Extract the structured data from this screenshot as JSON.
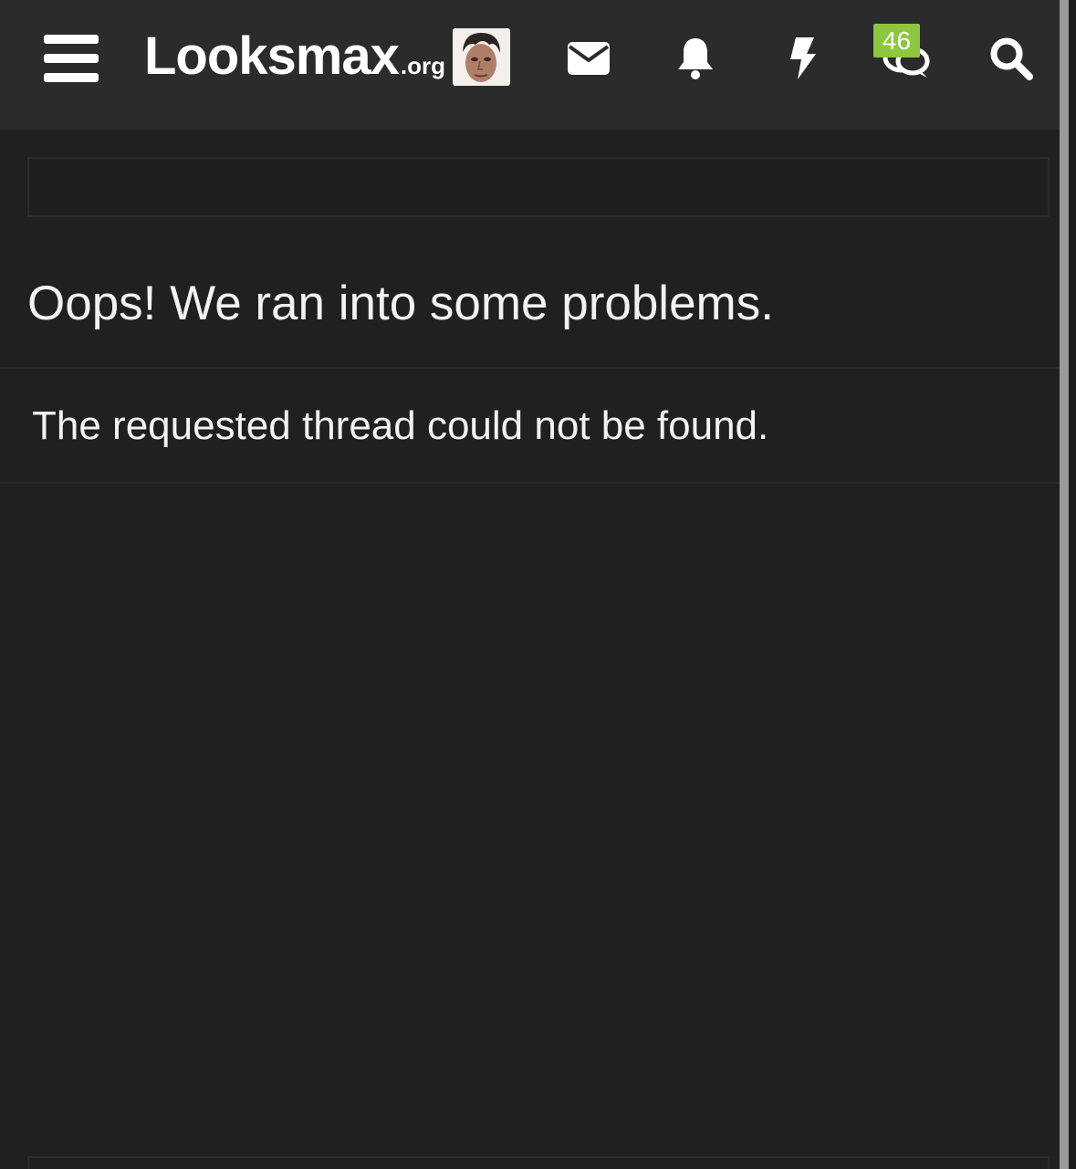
{
  "header": {
    "logo_main": "Looksmax",
    "logo_tld": ".org",
    "conversations_badge": "46",
    "icons": {
      "menu": "hamburger-menu-icon",
      "avatar": "user-avatar",
      "inbox": "envelope-icon",
      "alerts": "bell-icon",
      "whats_new": "lightning-bolt-icon",
      "conversations": "chat-bubbles-icon",
      "search": "search-icon"
    }
  },
  "error": {
    "title": "Oops! We ran into some problems.",
    "message": "The requested thread could not be found."
  },
  "colors": {
    "page_background": "#202020",
    "header_background": "#2b2b2b",
    "badge": "#8dc63f",
    "text": "#f2f2f2"
  }
}
